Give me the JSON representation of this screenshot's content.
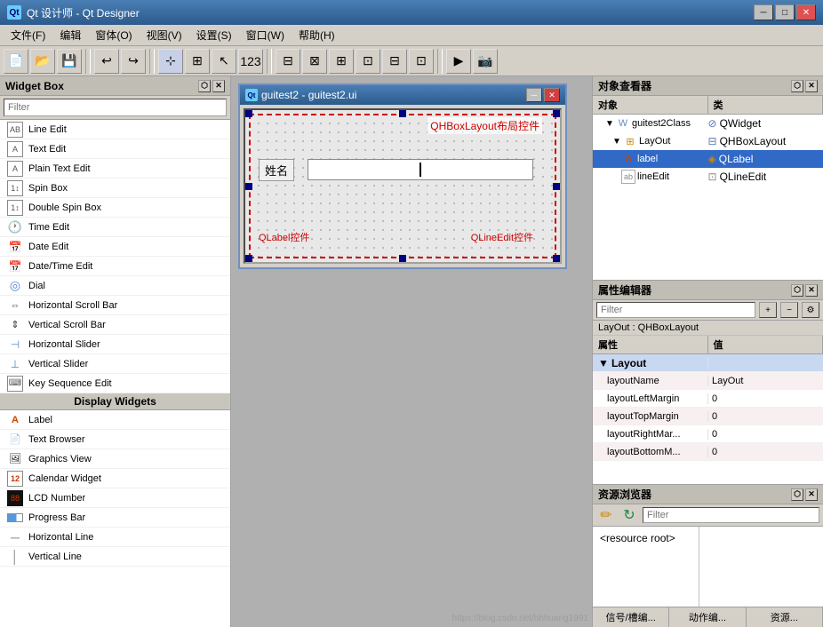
{
  "titleBar": {
    "icon": "Qt",
    "title": "Qt 设计师 - Qt Designer",
    "minBtn": "─",
    "maxBtn": "□",
    "closeBtn": "✕"
  },
  "menuBar": {
    "items": [
      {
        "id": "file",
        "label": "文件(F)"
      },
      {
        "id": "edit",
        "label": "编辑"
      },
      {
        "id": "window",
        "label": "窗体(O)"
      },
      {
        "id": "view",
        "label": "视图(V)"
      },
      {
        "id": "settings",
        "label": "设置(S)"
      },
      {
        "id": "window2",
        "label": "窗口(W)"
      },
      {
        "id": "help",
        "label": "帮助(H)"
      }
    ]
  },
  "widgetBox": {
    "title": "Widget Box",
    "filterPlaceholder": "Filter",
    "items": [
      {
        "id": "line-edit",
        "label": "Line Edit",
        "icon": "AB",
        "category": "input"
      },
      {
        "id": "text-edit",
        "label": "Text Edit",
        "icon": "A",
        "category": "input"
      },
      {
        "id": "plain-text-edit",
        "label": "Plain Text Edit",
        "icon": "A",
        "category": "input"
      },
      {
        "id": "spin-box",
        "label": "Spin Box",
        "icon": "12",
        "category": "input"
      },
      {
        "id": "double-spin-box",
        "label": "Double Spin Box",
        "icon": "1.",
        "category": "input"
      },
      {
        "id": "time-edit",
        "label": "Time Edit",
        "icon": "🕐",
        "category": "input"
      },
      {
        "id": "date-edit",
        "label": "Date Edit",
        "icon": "📅",
        "category": "input"
      },
      {
        "id": "date-time-edit",
        "label": "Date/Time Edit",
        "icon": "📅",
        "category": "input"
      },
      {
        "id": "dial",
        "label": "Dial",
        "icon": "◎",
        "category": "input"
      },
      {
        "id": "horizontal-scroll-bar",
        "label": "Horizontal Scroll Bar",
        "icon": "⇔",
        "category": "input"
      },
      {
        "id": "vertical-scroll-bar",
        "label": "Vertical Scroll Bar",
        "icon": "⇕",
        "category": "input"
      },
      {
        "id": "horizontal-slider",
        "label": "Horizontal Slider",
        "icon": "⊣",
        "category": "input"
      },
      {
        "id": "vertical-slider",
        "label": "Vertical Slider",
        "icon": "⊥",
        "category": "input"
      },
      {
        "id": "key-sequence-edit",
        "label": "Key Sequence Edit",
        "icon": "⌨",
        "category": "input"
      },
      {
        "id": "display-widgets-header",
        "label": "Display Widgets",
        "type": "category"
      },
      {
        "id": "label",
        "label": "Label",
        "icon": "A",
        "category": "display"
      },
      {
        "id": "text-browser",
        "label": "Text Browser",
        "icon": "📄",
        "category": "display"
      },
      {
        "id": "graphics-view",
        "label": "Graphics View",
        "icon": "🖼",
        "category": "display"
      },
      {
        "id": "calendar-widget",
        "label": "Calendar Widget",
        "icon": "12",
        "category": "display"
      },
      {
        "id": "lcd-number",
        "label": "LCD Number",
        "icon": "88",
        "category": "display"
      },
      {
        "id": "progress-bar",
        "label": "Progress Bar",
        "icon": "▬",
        "category": "display"
      },
      {
        "id": "horizontal-line",
        "label": "Horizontal Line",
        "icon": "─",
        "category": "display"
      },
      {
        "id": "vertical-line",
        "label": "Vertical Line",
        "icon": "│",
        "category": "display"
      }
    ]
  },
  "innerWindow": {
    "title": "guitest2 - guitest2.ui",
    "hboxLabel": "QHBoxLayout布局控件",
    "formLabel": "姓名",
    "qlabelText": "QLabel控件",
    "qlineEditText": "QLineEdit控件"
  },
  "objectInspector": {
    "title": "对象查看器",
    "columns": [
      "对象",
      "类"
    ],
    "tree": [
      {
        "id": "guitest2class",
        "name": "guitest2Class",
        "class": "QWidget",
        "level": 0,
        "expanded": true,
        "icon": "W"
      },
      {
        "id": "layout",
        "name": "LayOut",
        "class": "QHBoxLayout",
        "level": 1,
        "expanded": true,
        "icon": "L"
      },
      {
        "id": "label",
        "name": "label",
        "class": "QLabel",
        "level": 2,
        "expanded": false,
        "icon": "L"
      },
      {
        "id": "lineedit",
        "name": "lineEdit",
        "class": "QLineEdit",
        "level": 2,
        "expanded": false,
        "icon": "E"
      }
    ]
  },
  "propertyEditor": {
    "title": "属性编辑器",
    "filterPlaceholder": "Filter",
    "layoutLabel": "LayOut : QHBoxLayout",
    "columns": [
      "属性",
      "值"
    ],
    "properties": [
      {
        "id": "layout-group",
        "name": "Layout",
        "value": "",
        "type": "group"
      },
      {
        "id": "layout-name",
        "name": "layoutName",
        "value": "LayOut",
        "type": "alt"
      },
      {
        "id": "layout-left-margin",
        "name": "layoutLeftMargin",
        "value": "0",
        "type": "normal"
      },
      {
        "id": "layout-top-margin",
        "name": "layoutTopMargin",
        "value": "0",
        "type": "alt"
      },
      {
        "id": "layout-right-margin",
        "name": "layoutRightMar...",
        "value": "0",
        "type": "normal"
      },
      {
        "id": "layout-bottom-margin",
        "name": "layoutBottomM...",
        "value": "0",
        "type": "alt"
      }
    ]
  },
  "resourceBrowser": {
    "title": "资源浏览器",
    "filterPlaceholder": "Filter",
    "editIcon": "✏",
    "refreshIcon": "↻",
    "rootItem": "<resource root>",
    "footerButtons": [
      "信号/槽编...",
      "动作编...",
      "资源..."
    ]
  },
  "icons": {
    "plus": "+",
    "minus": "−",
    "wrench": "⚙",
    "pin": "📌",
    "close": "✕",
    "minimize": "─",
    "maximize": "□",
    "refresh": "↻",
    "edit": "✏"
  }
}
